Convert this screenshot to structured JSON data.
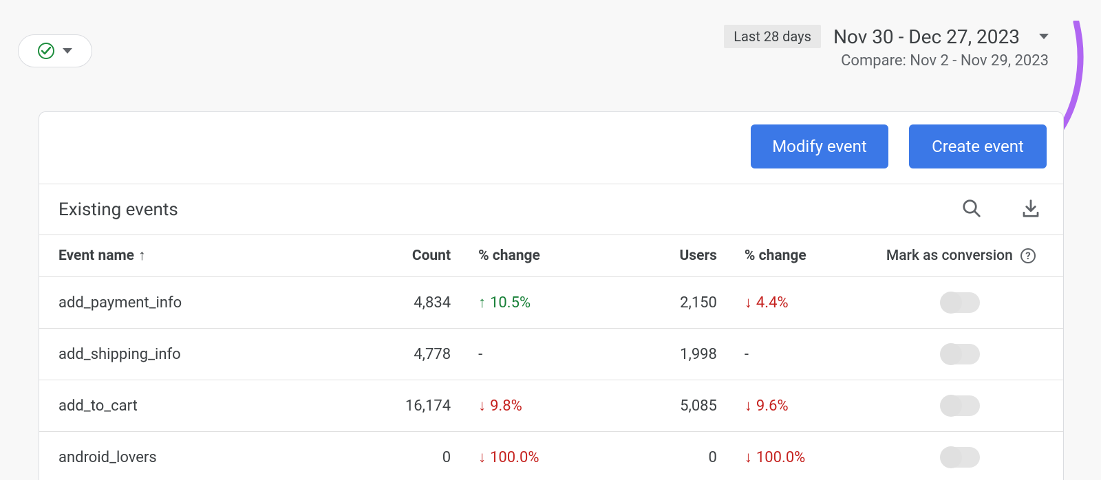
{
  "header": {
    "date_preset": "Last 28 days",
    "date_range": "Nov 30 - Dec 27, 2023",
    "compare_label": "Compare: Nov 2 - Nov 29, 2023"
  },
  "actions": {
    "modify_label": "Modify event",
    "create_label": "Create event"
  },
  "section": {
    "title": "Existing events"
  },
  "table": {
    "columns": {
      "name": "Event name",
      "count": "Count",
      "count_change": "% change",
      "users": "Users",
      "users_change": "% change",
      "conversion": "Mark as conversion"
    },
    "rows": [
      {
        "name": "add_payment_info",
        "count": "4,834",
        "count_change": {
          "dir": "up",
          "value": "10.5%"
        },
        "users": "2,150",
        "users_change": {
          "dir": "down",
          "value": "4.4%"
        },
        "conversion": false
      },
      {
        "name": "add_shipping_info",
        "count": "4,778",
        "count_change": {
          "dir": "none",
          "value": "-"
        },
        "users": "1,998",
        "users_change": {
          "dir": "none",
          "value": "-"
        },
        "conversion": false
      },
      {
        "name": "add_to_cart",
        "count": "16,174",
        "count_change": {
          "dir": "down",
          "value": "9.8%"
        },
        "users": "5,085",
        "users_change": {
          "dir": "down",
          "value": "9.6%"
        },
        "conversion": false
      },
      {
        "name": "android_lovers",
        "count": "0",
        "count_change": {
          "dir": "down",
          "value": "100.0%"
        },
        "users": "0",
        "users_change": {
          "dir": "down",
          "value": "100.0%"
        },
        "conversion": false
      }
    ]
  }
}
